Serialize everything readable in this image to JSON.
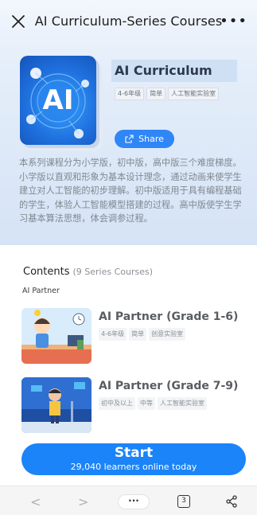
{
  "header": {
    "title": "AI Curriculum-Series Courses"
  },
  "course": {
    "cover_text": "AI",
    "name": "AI Curriculum",
    "tags": [
      "4-6年级",
      "简单",
      "人工智能实验室"
    ],
    "share_label": "Share",
    "description": "本系列课程分为小学版，初中版，高中版三个难度梯度。小学版以直观和形象为基本设计理念，通过动画来使学生建立对人工智能的初步理解。初中版适用于具有编程基础的学生，体验人工智能模型搭建的过程。高中版使学生学习基本算法思想，体会调参过程。"
  },
  "contents": {
    "title": "Contents",
    "count": "(9 Series Courses)",
    "section_label": "AI Partner",
    "items": [
      {
        "title": "AI Partner (Grade 1-6)",
        "tags": [
          "4-6年级",
          "简单",
          "创意实验室"
        ]
      },
      {
        "title": "AI Partner (Grade 7-9)",
        "tags": [
          "初中及以上",
          "中等",
          "人工智能实验室"
        ]
      }
    ]
  },
  "start": {
    "label": "Start",
    "sub": "29,040 learners online today"
  },
  "browser": {
    "back": "<",
    "forward": ">",
    "menu": "···",
    "tab_count": "3"
  },
  "colors": {
    "accent": "#1a84f8",
    "hero_bg": "#d5e3f6"
  },
  "icons": [
    "close-icon",
    "more-icon",
    "share-icon",
    "back-icon",
    "forward-icon",
    "tabs-icon",
    "browser-share-icon"
  ]
}
